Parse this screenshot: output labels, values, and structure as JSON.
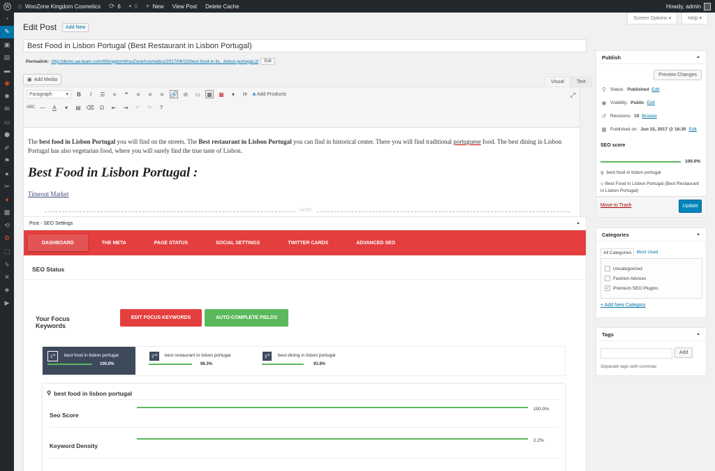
{
  "adminbar": {
    "site_name": "WooZone Kingdom Cosmetics",
    "updates_count": "6",
    "comments_count": "0",
    "new_label": "New",
    "view_post_label": "View Post",
    "delete_cache_label": "Delete Cache",
    "howdy": "Howdy, admin"
  },
  "screen": {
    "screen_options": "Screen Options",
    "help": "Help"
  },
  "page": {
    "title": "Edit Post",
    "add_new": "Add New"
  },
  "post": {
    "title": "Best Food in Lisbon Portugal (Best Restaurant in Lisbon Portugal)",
    "permalink_label": "Permalink:",
    "permalink_url": "http://demo.aa-team.com/tf/kingdomWooZone/cosmetics/2017/06/15/best-food-in-lis...lisbon-portugal-2/",
    "edit_label": "Edit"
  },
  "editor": {
    "add_media": "Add Media",
    "tab_visual": "Visual",
    "tab_text": "Text",
    "format_select": "Paragraph",
    "add_products": "Add Products",
    "p1_a": "The ",
    "p1_b": "best food in Lisbon Portugal",
    "p1_c": " you will find on the streets. The ",
    "p1_d": "Best restaurant in Lisbon Portugal",
    "p1_e": " you can find in historical center. There you will find traditional ",
    "p1_f": "portuguese",
    "p1_g": " food. The best dining in Lisbon Portugal has also vegetarian food, where you will surely find the true taste of Lisbon.",
    "heading": "Best Food in Lisbon Portugal :",
    "link": "Timeout Market",
    "more": "MORE"
  },
  "seo": {
    "box_title": "Post - SEO Settings",
    "tabs": [
      "DASHBOARD",
      "THE META",
      "PAGE STATUS",
      "SOCIAL SETTINGS",
      "TWITTER CARDS",
      "ADVANCED SEO"
    ],
    "status_title": "SEO Status",
    "focus_title": "Your Focus Keywords",
    "edit_btn": "EDIT FOCUS KEYWORDS",
    "auto_btn": "AUTO-COMPLETE FIELDS",
    "keywords": [
      {
        "rank": "1",
        "suffix": "st",
        "name": "best food in lisbon portugal",
        "score": 100.0,
        "pct": "100.0%"
      },
      {
        "rank": "2",
        "suffix": "nd",
        "name": "best restaurant in lisbon portugal",
        "score": 96.3,
        "pct": "96.3%"
      },
      {
        "rank": "3",
        "suffix": "rd",
        "name": "best dining in lisbon portugal",
        "score": 93.8,
        "pct": "93.8%"
      }
    ],
    "selected_keyword": "best food in lisbon portugal",
    "stats": [
      {
        "label": "Seo Score",
        "value": "100.0%",
        "fraction": 1.0
      },
      {
        "label": "Keyword Density",
        "value": "2.2%",
        "fraction": 1.0
      }
    ]
  },
  "publish": {
    "title": "Publish",
    "preview": "Preview Changes",
    "status_label": "Status:",
    "status_value": "Published",
    "visibility_label": "Visibility:",
    "visibility_value": "Public",
    "revisions_label": "Revisions:",
    "revisions_value": "19",
    "browse": "Browse",
    "published_label": "Published on:",
    "published_value": "Jun 15, 2017 @ 16:30",
    "edit": "Edit",
    "seo_score_title": "SEO score",
    "seo_score_value": "100.0%",
    "seo_score_fraction": 1.0,
    "focus_keyword": "best food in lisbon portugal",
    "seo_title": "Best Food in Lisbon Portugal (Best Restaurant in Lisbon Portugal)",
    "trash": "Move to Trash",
    "update": "Update"
  },
  "categories": {
    "title": "Categories",
    "tab_all": "All Categories",
    "tab_most": "Most Used",
    "items": [
      {
        "label": "Uncategorized",
        "checked": false
      },
      {
        "label": "Fashion Advices",
        "checked": false
      },
      {
        "label": "Premium SEO Plugins",
        "checked": true
      }
    ],
    "add_new": "+ Add New Category"
  },
  "tags": {
    "title": "Tags",
    "add": "Add",
    "hint": "Separate tags with commas"
  },
  "colors": {
    "admin_bar": "#23282d",
    "primary_blue": "#0073aa",
    "seo_red": "#e43e3e",
    "success_green": "#5cb85c"
  }
}
